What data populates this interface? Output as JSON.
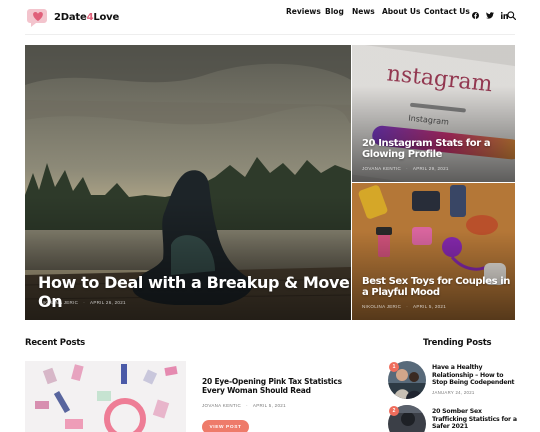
{
  "site": {
    "logo_prefix": "2Date",
    "logo_accent": "4",
    "logo_suffix": "Love",
    "brand_color": "#e0607a"
  },
  "nav": {
    "items": [
      "Reviews",
      "Blog",
      "News",
      "About Us",
      "Contact Us"
    ],
    "social_icons": [
      "facebook-icon",
      "twitter-icon",
      "linkedin-icon"
    ],
    "search_icon": "search-icon"
  },
  "hero": {
    "main": {
      "title": "How to Deal with a Breakup & Move On",
      "author": "NIKOLINA JERIC",
      "date": "APRIL 26, 2021"
    },
    "side_top": {
      "title": "20 Instagram Stats for a Glowing Profile",
      "author": "JOVANA KENTIC",
      "date": "APRIL 29, 2021"
    },
    "side_bottom": {
      "title": "Best Sex Toys for Couples in a Playful Mood",
      "author": "NIKOLINA JERIC",
      "date": "APRIL 5, 2021"
    }
  },
  "recent": {
    "heading": "Recent Posts",
    "post": {
      "title": "20 Eye-Opening Pink Tax Statistics Every Woman Should Read",
      "author": "JOVANA KENTIC",
      "date": "APRIL 5, 2021",
      "button": "VIEW POST"
    }
  },
  "trending": {
    "heading": "Trending Posts",
    "items": [
      {
        "num": "1",
        "title": "Have a Healthy Relationship – How to Stop Being Codependent",
        "date": "JANUARY 24, 2021"
      },
      {
        "num": "2",
        "title": "20 Somber Sex Trafficking Statistics for a Safer 2021",
        "date": ""
      }
    ]
  },
  "colors": {
    "accent": "#ee7b6a",
    "badge": "#ef6d5c"
  }
}
